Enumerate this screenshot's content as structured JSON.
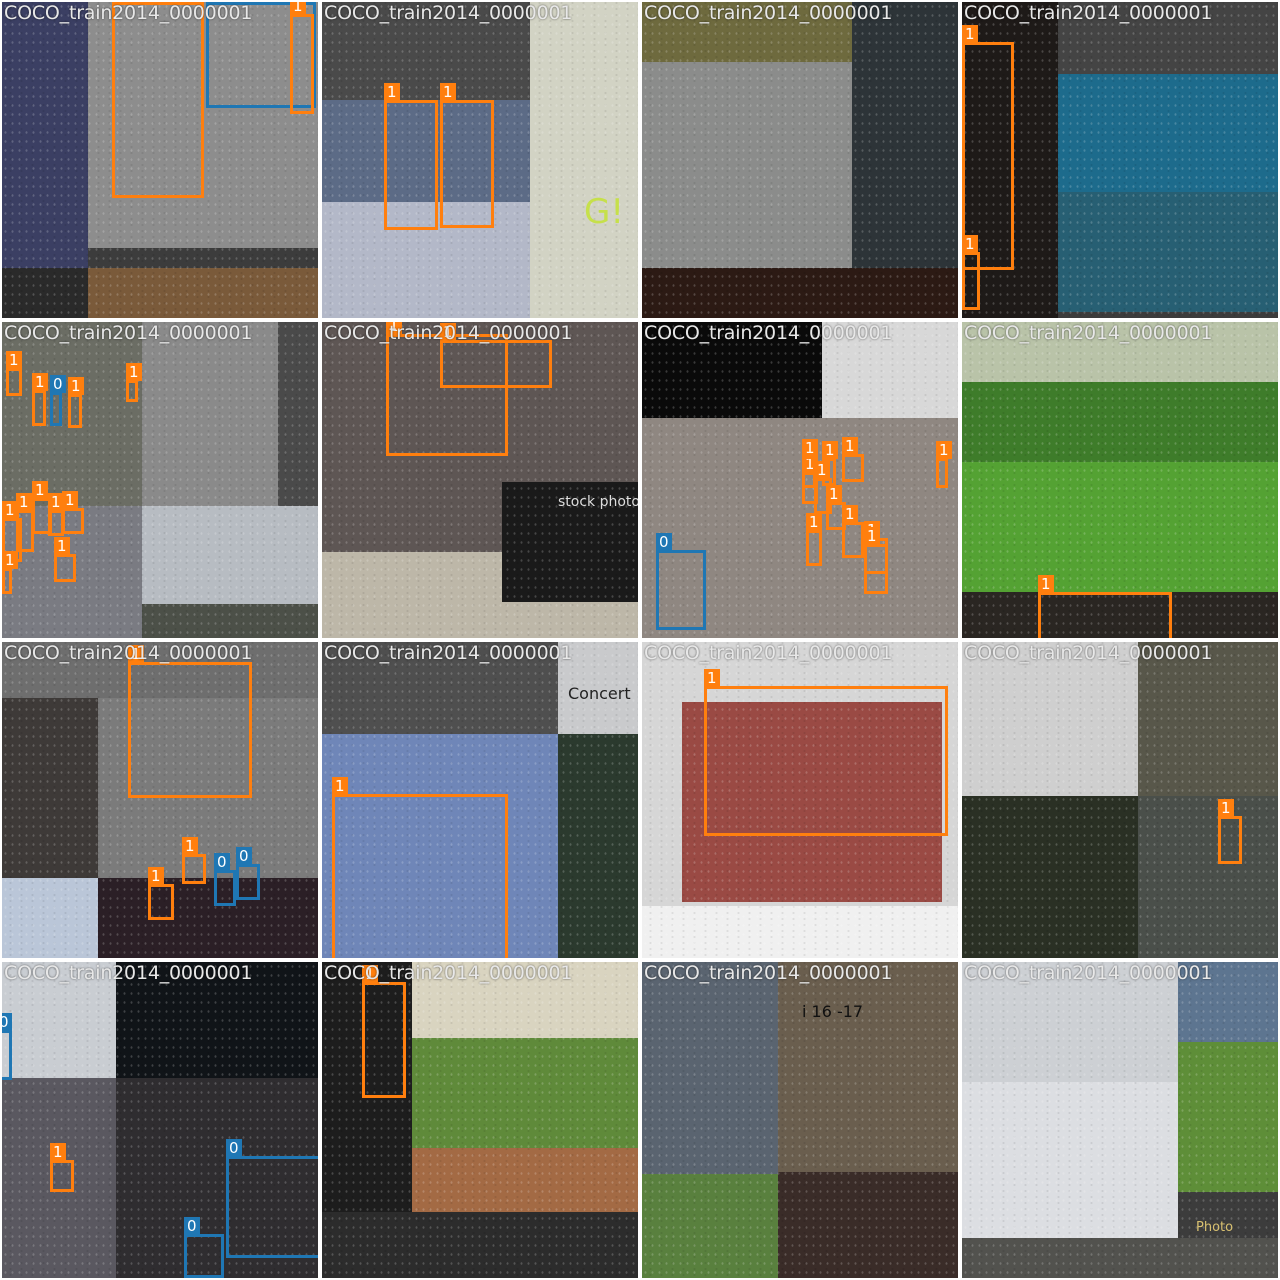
{
  "mosaic": {
    "tiles": [
      {
        "filename": "COCO_train2014_0000001",
        "boxes": [
          {
            "cls": "1"
          },
          {
            "cls": "0"
          },
          {
            "cls": "1"
          }
        ]
      },
      {
        "filename": "COCO_train2014_0000001",
        "boxes": [
          {
            "cls": "1"
          },
          {
            "cls": "1"
          }
        ]
      },
      {
        "filename": "COCO_train2014_0000001",
        "boxes": []
      },
      {
        "filename": "COCO_train2014_0000001",
        "boxes": [
          {
            "cls": "1"
          },
          {
            "cls": "1"
          }
        ]
      },
      {
        "filename": "COCO_train2014_0000001",
        "boxes": [
          {
            "cls": "1"
          },
          {
            "cls": "1"
          },
          {
            "cls": "0"
          },
          {
            "cls": "1"
          },
          {
            "cls": "1"
          },
          {
            "cls": "1"
          },
          {
            "cls": "1"
          },
          {
            "cls": "1"
          },
          {
            "cls": "1"
          },
          {
            "cls": "1"
          },
          {
            "cls": "1"
          },
          {
            "cls": "1"
          }
        ]
      },
      {
        "filename": "COCO_train2014_0000001",
        "boxes": [
          {
            "cls": "1"
          },
          {
            "cls": "1"
          }
        ]
      },
      {
        "filename": "COCO_train2014_0000001",
        "boxes": [
          {
            "cls": "0"
          },
          {
            "cls": "1"
          },
          {
            "cls": "1"
          },
          {
            "cls": "1"
          },
          {
            "cls": "1"
          },
          {
            "cls": "1"
          },
          {
            "cls": "1"
          },
          {
            "cls": "1"
          },
          {
            "cls": "1"
          },
          {
            "cls": "1"
          },
          {
            "cls": "1"
          },
          {
            "cls": "1"
          }
        ]
      },
      {
        "filename": "COCO_train2014_0000001",
        "boxes": [
          {
            "cls": "1"
          }
        ]
      },
      {
        "filename": "COCO_train2014_0000001",
        "boxes": [
          {
            "cls": "1"
          },
          {
            "cls": "1"
          },
          {
            "cls": "1"
          },
          {
            "cls": "0"
          },
          {
            "cls": "0"
          }
        ]
      },
      {
        "filename": "COCO_train2014_0000001",
        "boxes": [
          {
            "cls": "1"
          }
        ]
      },
      {
        "filename": "COCO_train2014_0000001",
        "boxes": [
          {
            "cls": "1"
          }
        ]
      },
      {
        "filename": "COCO_train2014_0000001",
        "boxes": [
          {
            "cls": "1"
          }
        ]
      },
      {
        "filename": "COCO_train2014_0000001",
        "boxes": [
          {
            "cls": "0"
          },
          {
            "cls": "1"
          },
          {
            "cls": "0"
          },
          {
            "cls": "0"
          }
        ]
      },
      {
        "filename": "COCO_train2014_0000001",
        "boxes": [
          {
            "cls": "1"
          }
        ]
      },
      {
        "filename": "COCO_train2014_0000001",
        "boxes": []
      },
      {
        "filename": "COCO_train2014_0000001",
        "boxes": []
      }
    ]
  },
  "photo_text": {
    "t11_sign": "Concert",
    "t1_sign": "G!",
    "t5_stock": "stock photo",
    "t14_sign": "i 16 -17",
    "t15_stamp": "Photo"
  },
  "colors": {
    "class1": "#ff7f0e",
    "class0": "#1f77b4",
    "label_text": "#ffffff"
  }
}
